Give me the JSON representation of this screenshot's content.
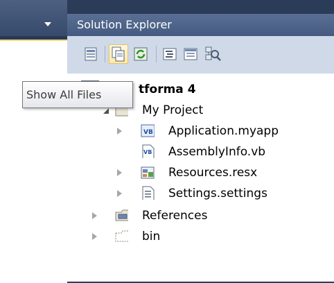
{
  "panel": {
    "title": "Solution Explorer"
  },
  "toolbar": {
    "buttons": [
      {
        "name": "properties-icon"
      },
      {
        "name": "show-all-files-icon",
        "active": true
      },
      {
        "name": "refresh-icon"
      },
      {
        "name": "view-code-icon"
      },
      {
        "name": "view-designer-icon"
      },
      {
        "name": "class-diagram-icon"
      }
    ]
  },
  "tooltip": {
    "text": "Show All Files"
  },
  "tree": {
    "project_label": "tforma 4",
    "items": [
      {
        "label": "My Project"
      },
      {
        "label": "Application.myapp"
      },
      {
        "label": "AssemblyInfo.vb"
      },
      {
        "label": "Resources.resx"
      },
      {
        "label": "Settings.settings"
      },
      {
        "label": "References"
      },
      {
        "label": "bin"
      }
    ]
  },
  "colors": {
    "accent": "#3f577c",
    "tooltip_border": "#767676",
    "active_button": "#ffe9a8"
  }
}
